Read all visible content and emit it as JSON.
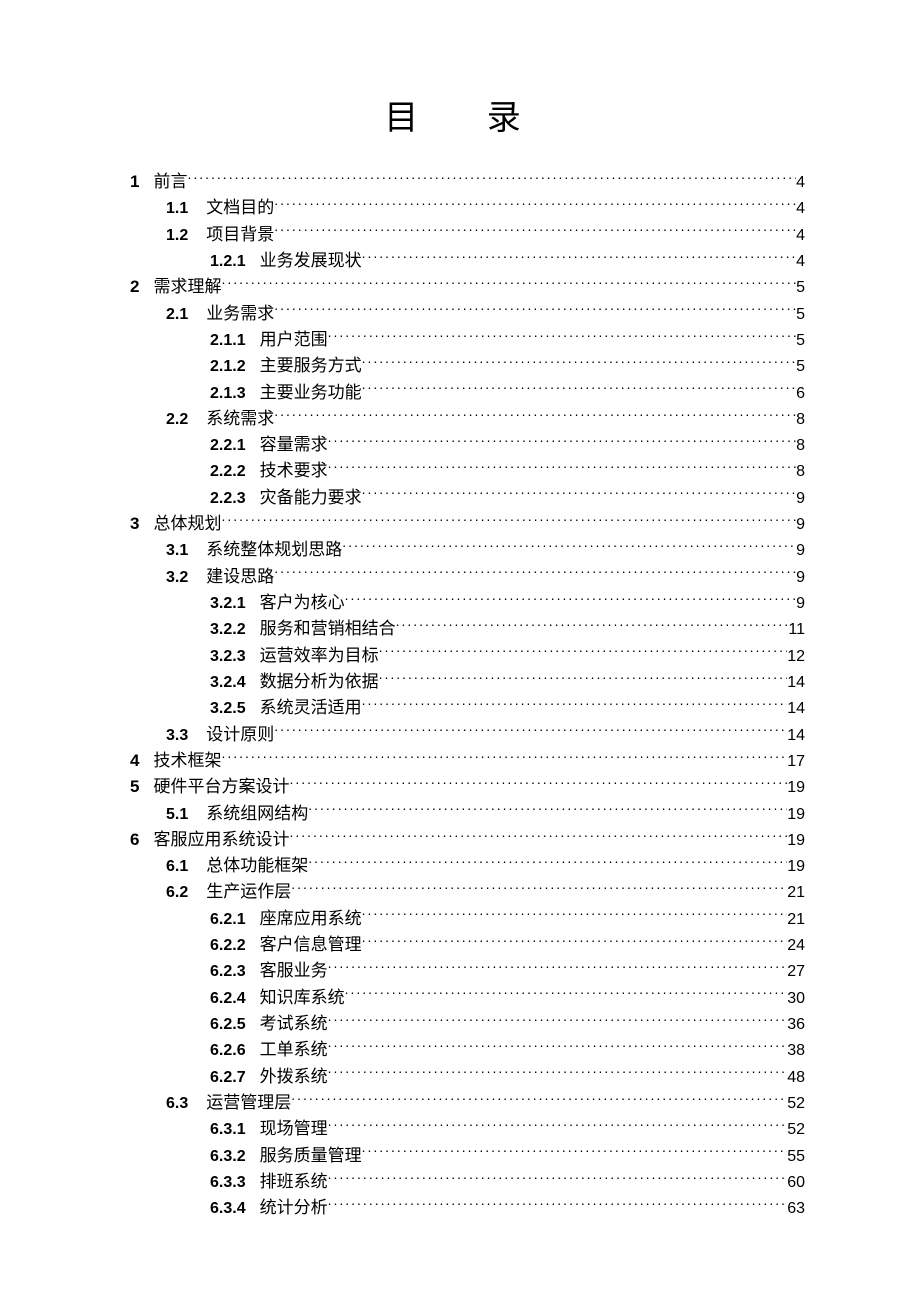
{
  "title": "目 录",
  "entries": [
    {
      "level": 0,
      "num": "1",
      "label": "前言",
      "page": "4"
    },
    {
      "level": 1,
      "num": "1.1",
      "label": "文档目的",
      "page": "4"
    },
    {
      "level": 1,
      "num": "1.2",
      "label": "项目背景",
      "page": "4"
    },
    {
      "level": 2,
      "num": "1.2.1",
      "label": "业务发展现状",
      "page": "4"
    },
    {
      "level": 0,
      "num": "2",
      "label": "需求理解",
      "page": "5"
    },
    {
      "level": 1,
      "num": "2.1",
      "label": "业务需求",
      "page": "5"
    },
    {
      "level": 2,
      "num": "2.1.1",
      "label": "用户范围",
      "page": "5"
    },
    {
      "level": 2,
      "num": "2.1.2",
      "label": "主要服务方式",
      "page": "5"
    },
    {
      "level": 2,
      "num": "2.1.3",
      "label": "主要业务功能",
      "page": "6"
    },
    {
      "level": 1,
      "num": "2.2",
      "label": "系统需求",
      "page": "8"
    },
    {
      "level": 2,
      "num": "2.2.1",
      "label": "容量需求",
      "page": "8"
    },
    {
      "level": 2,
      "num": "2.2.2",
      "label": "技术要求",
      "page": "8"
    },
    {
      "level": 2,
      "num": "2.2.3",
      "label": "灾备能力要求",
      "page": "9"
    },
    {
      "level": 0,
      "num": "3",
      "label": "总体规划",
      "page": "9"
    },
    {
      "level": 1,
      "num": "3.1",
      "label": "系统整体规划思路",
      "page": "9"
    },
    {
      "level": 1,
      "num": "3.2",
      "label": "建设思路",
      "page": "9"
    },
    {
      "level": 2,
      "num": "3.2.1",
      "label": "客户为核心",
      "page": "9"
    },
    {
      "level": 2,
      "num": "3.2.2",
      "label": "服务和营销相结合",
      "page": "11"
    },
    {
      "level": 2,
      "num": "3.2.3",
      "label": "运营效率为目标",
      "page": "12"
    },
    {
      "level": 2,
      "num": "3.2.4",
      "label": "数据分析为依据",
      "page": "14"
    },
    {
      "level": 2,
      "num": "3.2.5",
      "label": "系统灵活适用",
      "page": "14"
    },
    {
      "level": 1,
      "num": "3.3",
      "label": "设计原则",
      "page": "14"
    },
    {
      "level": 0,
      "num": "4",
      "label": "技术框架",
      "page": "17"
    },
    {
      "level": 0,
      "num": "5",
      "label": "硬件平台方案设计",
      "page": "19"
    },
    {
      "level": 1,
      "num": "5.1",
      "label": "系统组网结构",
      "page": "19"
    },
    {
      "level": 0,
      "num": "6",
      "label": "客服应用系统设计",
      "page": "19"
    },
    {
      "level": 1,
      "num": "6.1",
      "label": "总体功能框架",
      "page": "19"
    },
    {
      "level": 1,
      "num": "6.2",
      "label": "生产运作层",
      "page": "21"
    },
    {
      "level": 2,
      "num": "6.2.1",
      "label": "座席应用系统",
      "page": "21"
    },
    {
      "level": 2,
      "num": "6.2.2",
      "label": "客户信息管理",
      "page": "24"
    },
    {
      "level": 2,
      "num": "6.2.3",
      "label": "客服业务",
      "page": "27"
    },
    {
      "level": 2,
      "num": "6.2.4",
      "label": "知识库系统",
      "page": "30"
    },
    {
      "level": 2,
      "num": "6.2.5",
      "label": "考试系统",
      "page": "36"
    },
    {
      "level": 2,
      "num": "6.2.6",
      "label": "工单系统",
      "page": "38"
    },
    {
      "level": 2,
      "num": "6.2.7",
      "label": "外拨系统",
      "page": "48"
    },
    {
      "level": 1,
      "num": "6.3",
      "label": "运营管理层",
      "page": "52"
    },
    {
      "level": 2,
      "num": "6.3.1",
      "label": "现场管理",
      "page": "52"
    },
    {
      "level": 2,
      "num": "6.3.2",
      "label": "服务质量管理",
      "page": "55"
    },
    {
      "level": 2,
      "num": "6.3.3",
      "label": "排班系统",
      "page": "60"
    },
    {
      "level": 2,
      "num": "6.3.4",
      "label": "统计分析",
      "page": "63"
    }
  ]
}
